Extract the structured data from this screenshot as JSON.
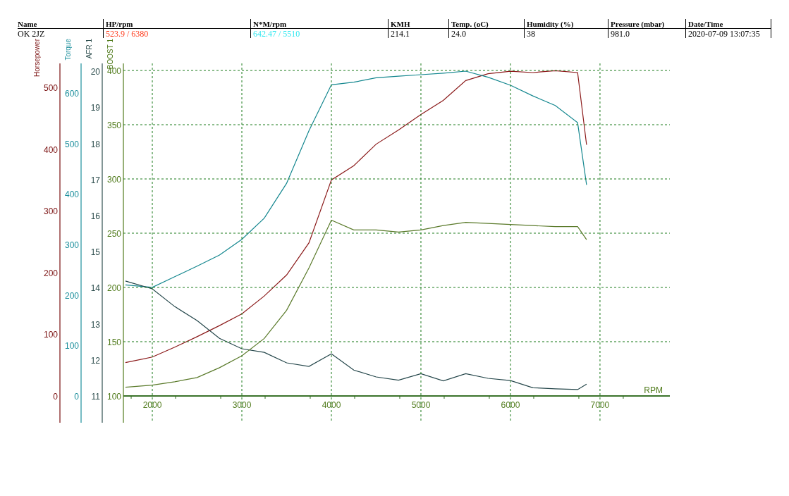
{
  "header": {
    "columns": [
      "Name",
      "HP/rpm",
      "N*M/rpm",
      "KMH",
      "Temp. (oC)",
      "Humidity (%)",
      "Pressure (mbar)",
      "Date/Time"
    ],
    "row": [
      {
        "text": "OK 2JZ"
      },
      {
        "text": "523.9 / 6380",
        "color": "#ff3a1a"
      },
      {
        "text": "642.47 / 5510",
        "color": "#33e8f0"
      },
      {
        "text": "214.1"
      },
      {
        "text": "24.0"
      },
      {
        "text": " 38"
      },
      {
        "text": "981.0"
      },
      {
        "text": "2020-07-09 13:07:35"
      }
    ]
  },
  "chart": {
    "layers": [
      {
        "chart_data": {
          "type": "line",
          "xlim": [
            1677,
            7780
          ],
          "ylim": [
            -43.4,
            538.8
          ],
          "yticks": [
            0,
            100,
            200,
            300,
            400,
            500
          ],
          "x": [
            1700,
            2000,
            2250,
            2500,
            2750,
            3000,
            3250,
            3500,
            3750,
            4000,
            4250,
            4500,
            4750,
            5000,
            5250,
            5500,
            5750,
            6000,
            6250,
            6500,
            6750,
            6850
          ],
          "series": [
            {
              "name": "Horsepower",
              "color": "#8b1a1a",
              "values": [
                54,
                63,
                79,
                96,
                114,
                133,
                162,
                196,
                248,
                350,
                373,
                408,
                431,
                456,
                479,
                511,
                522,
                526,
                524,
                527,
                524,
                407
              ]
            }
          ]
        }
      },
      {
        "chart_data": {
          "type": "line",
          "xlim": [
            1677,
            7780
          ],
          "ylim": [
            -53,
            658.3
          ],
          "yticks": [
            0,
            100,
            200,
            300,
            400,
            500,
            600
          ],
          "x": [
            1700,
            2000,
            2250,
            2500,
            2750,
            3000,
            3250,
            3500,
            3750,
            4000,
            4250,
            4500,
            4750,
            5000,
            5250,
            5500,
            5750,
            6000,
            6250,
            6500,
            6750,
            6850
          ],
          "series": [
            {
              "name": "Torque",
              "color": "#14878f",
              "values": [
                220,
                215,
                236,
                257,
                279,
                310,
                352,
                421,
                525,
                616,
                621,
                630,
                633,
                636,
                639,
                643,
                631,
                615,
                594,
                575,
                541,
                418
              ]
            }
          ]
        }
      },
      {
        "chart_data": {
          "type": "line",
          "xlim": [
            1677,
            7780
          ],
          "ylim": [
            10.26,
            20.22
          ],
          "yticks": [
            11,
            12,
            13,
            14,
            15,
            16,
            17,
            18,
            19,
            20
          ],
          "x": [
            1700,
            2000,
            2250,
            2500,
            2750,
            3000,
            3250,
            3500,
            3750,
            4000,
            4250,
            4500,
            4750,
            5000,
            5250,
            5500,
            5750,
            6000,
            6250,
            6500,
            6750,
            6850
          ],
          "series": [
            {
              "name": "AFR 1",
              "color": "#24464a",
              "values": [
                14.19,
                13.97,
                13.48,
                13.09,
                12.6,
                12.31,
                12.21,
                11.92,
                11.82,
                12.17,
                11.72,
                11.53,
                11.44,
                11.62,
                11.42,
                11.62,
                11.49,
                11.43,
                11.23,
                11.2,
                11.18,
                11.33
              ]
            }
          ]
        }
      },
      {
        "chart_data": {
          "type": "line",
          "xlabel": "RPM",
          "grid": true,
          "xlim": [
            1677,
            7780
          ],
          "xticks": [
            2000,
            3000,
            4000,
            5000,
            6000,
            7000
          ],
          "ylim": [
            75.3,
            406.5
          ],
          "yticks": [
            100,
            150,
            200,
            250,
            300,
            350,
            400
          ],
          "x": [
            1700,
            2000,
            2250,
            2500,
            2750,
            3000,
            3250,
            3500,
            3750,
            4000,
            4250,
            4500,
            4750,
            5000,
            5250,
            5500,
            5750,
            6000,
            6250,
            6500,
            6750,
            6850
          ],
          "series": [
            {
              "name": "BOOST 1",
              "color": "#5a7a2a",
              "values": [
                108,
                110,
                113,
                117,
                126,
                137,
                153,
                179,
                218,
                262,
                253,
                253,
                251,
                253,
                257,
                260,
                259,
                258,
                257,
                256,
                256,
                244
              ]
            }
          ]
        }
      }
    ]
  }
}
